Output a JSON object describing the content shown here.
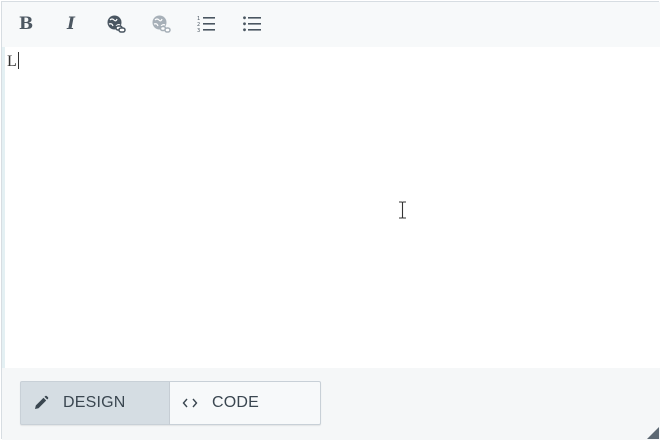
{
  "toolbar": {
    "bold_glyph": "B",
    "italic_glyph": "I",
    "buttons": [
      {
        "name": "bold",
        "icon": "bold-icon",
        "state": "enabled"
      },
      {
        "name": "italic",
        "icon": "italic-icon",
        "state": "enabled"
      },
      {
        "name": "insert-link",
        "icon": "globe-link-icon",
        "state": "enabled"
      },
      {
        "name": "remove-link",
        "icon": "globe-unlink-icon",
        "state": "disabled"
      },
      {
        "name": "ordered-list",
        "icon": "ordered-list-icon",
        "state": "enabled"
      },
      {
        "name": "unordered-list",
        "icon": "unordered-list-icon",
        "state": "enabled"
      }
    ]
  },
  "content": {
    "text": "L"
  },
  "modes": {
    "design_label": "DESIGN",
    "code_label": "CODE",
    "active": "design"
  },
  "colors": {
    "toolbar_bg": "#f7f9fa",
    "icon": "#4a5661",
    "icon_disabled": "#a7b0b8",
    "active_mode_bg": "#d5dde3",
    "content_bg": "#ffffff",
    "footer_bg": "#f5f7f8"
  }
}
